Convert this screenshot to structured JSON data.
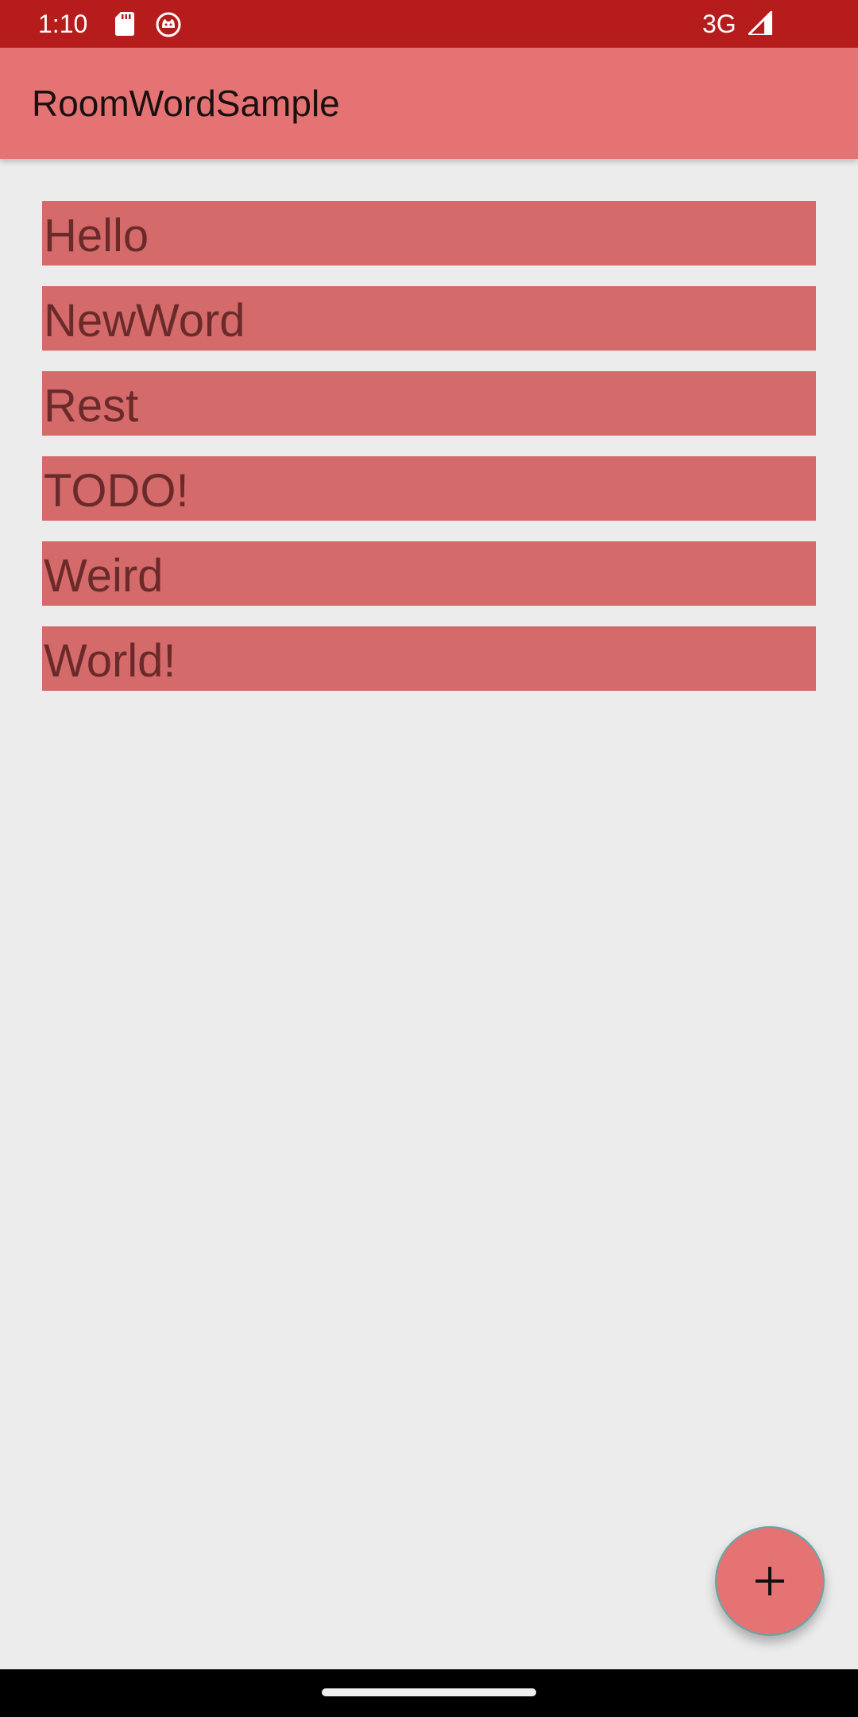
{
  "status_bar": {
    "time": "1:10",
    "network": "3G",
    "icons": [
      "sd-card-icon",
      "cat-notification-icon",
      "cellular-signal-icon"
    ]
  },
  "app_bar": {
    "title": "RoomWordSample"
  },
  "word_list": {
    "items": [
      {
        "label": "Hello"
      },
      {
        "label": "NewWord"
      },
      {
        "label": "Rest"
      },
      {
        "label": "TODO!"
      },
      {
        "label": "Weird"
      },
      {
        "label": "World!"
      }
    ]
  },
  "fab": {
    "icon": "plus-icon"
  },
  "colors": {
    "status_bar": "#b71c1c",
    "app_bar": "#e57373",
    "item_background": "#d46a6a",
    "item_text": "#6b2a2a",
    "screen_background": "#ececec"
  }
}
